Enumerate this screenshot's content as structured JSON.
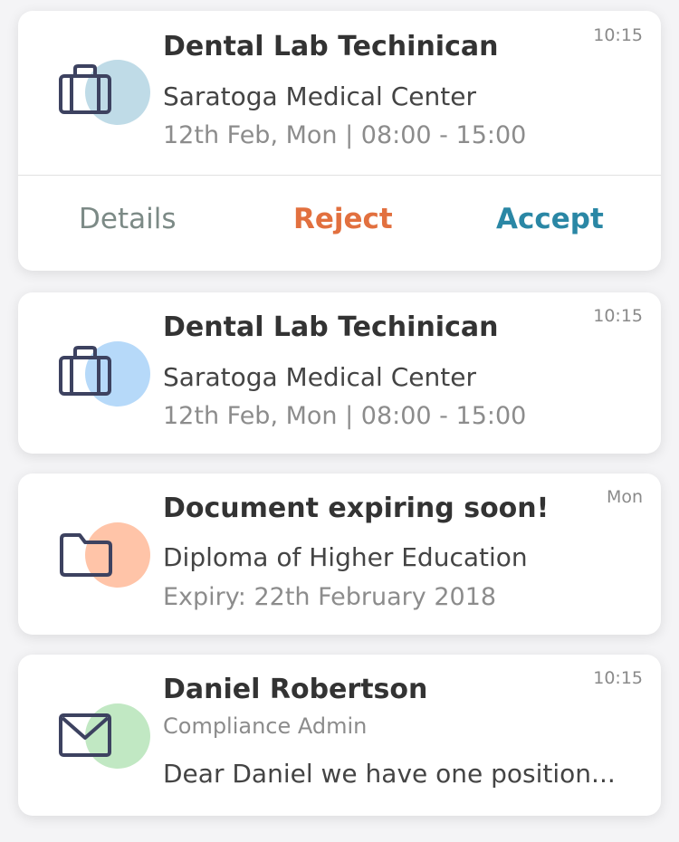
{
  "cards": [
    {
      "title": "Dental Lab Techinican",
      "line1": "Saratoga Medical Center",
      "line2": "12th Feb, Mon | 08:00 - 15:00",
      "time": "10:15",
      "icon": "briefcase-icon",
      "actions": {
        "details": "Details",
        "reject": "Reject",
        "accept": "Accept"
      }
    },
    {
      "title": "Dental Lab Techinican",
      "line1": "Saratoga Medical Center",
      "line2": "12th Feb, Mon | 08:00 - 15:00",
      "time": "10:15",
      "icon": "briefcase-icon"
    },
    {
      "title": "Document expiring soon!",
      "line1": "Diploma of Higher Education",
      "line2": "Expiry: 22th February 2018",
      "time": "Mon",
      "icon": "folder-icon"
    },
    {
      "title": "Daniel Robertson",
      "line1": "Compliance Admin",
      "line2": "Dear Daniel we have one position...",
      "time": "10:15",
      "icon": "mail-icon"
    }
  ],
  "colors": {
    "icon_stroke": "#3d4260",
    "circle_job_1": "#bfdbe7",
    "circle_job_2": "#b6d9f9",
    "circle_document": "#ffc4a8",
    "circle_message": "#c1e8c3",
    "details": "#7c8a86",
    "reject": "#e2703f",
    "accept": "#2a87a5"
  }
}
